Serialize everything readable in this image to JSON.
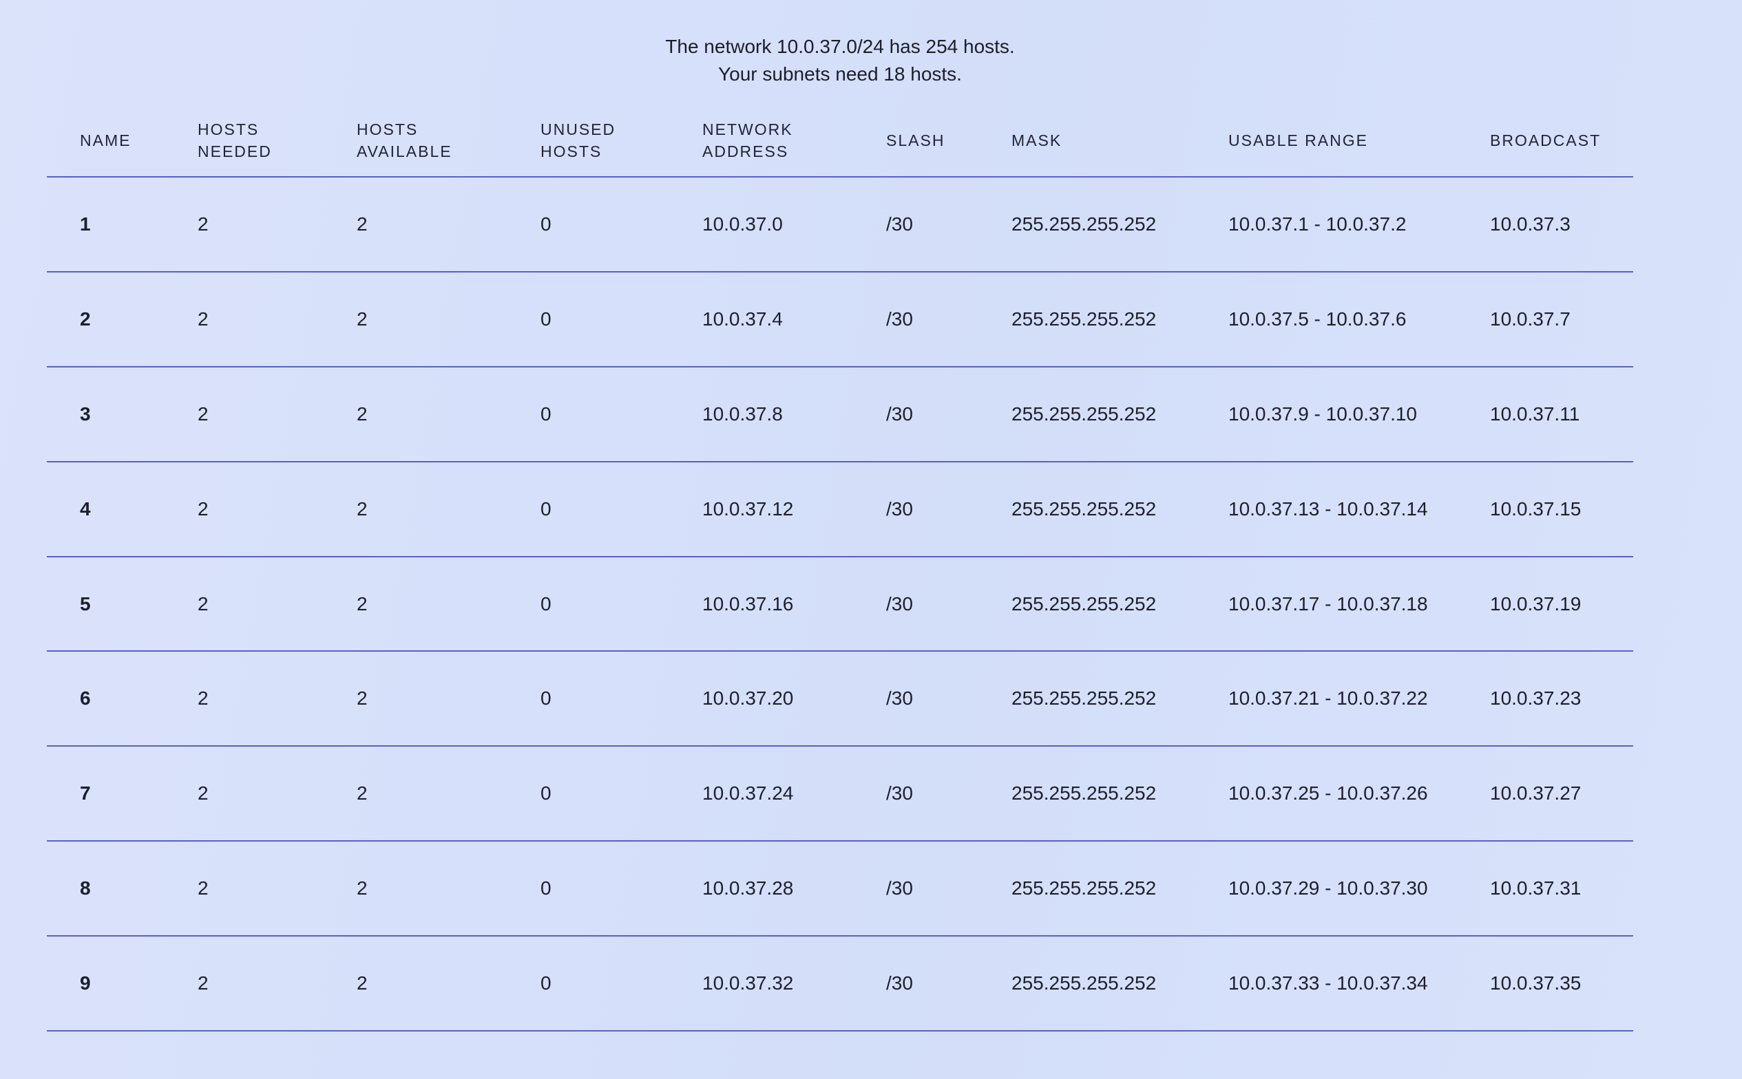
{
  "summary": {
    "line1": "The network 10.0.37.0/24 has 254 hosts.",
    "line2": "Your subnets need 18 hosts."
  },
  "table": {
    "headers": {
      "name": "NAME",
      "hosts_needed": "HOSTS\nNEEDED",
      "hosts_available": "HOSTS\nAVAILABLE",
      "unused_hosts": "UNUSED\nHOSTS",
      "network_address": "NETWORK\nADDRESS",
      "slash": "SLASH",
      "mask": "MASK",
      "usable_range": "USABLE RANGE",
      "broadcast": "BROADCAST"
    },
    "rows": [
      {
        "name": "1",
        "hosts_needed": "2",
        "hosts_available": "2",
        "unused_hosts": "0",
        "network_address": "10.0.37.0",
        "slash": "/30",
        "mask": "255.255.255.252",
        "usable_range": "10.0.37.1 - 10.0.37.2",
        "broadcast": "10.0.37.3"
      },
      {
        "name": "2",
        "hosts_needed": "2",
        "hosts_available": "2",
        "unused_hosts": "0",
        "network_address": "10.0.37.4",
        "slash": "/30",
        "mask": "255.255.255.252",
        "usable_range": "10.0.37.5 - 10.0.37.6",
        "broadcast": "10.0.37.7"
      },
      {
        "name": "3",
        "hosts_needed": "2",
        "hosts_available": "2",
        "unused_hosts": "0",
        "network_address": "10.0.37.8",
        "slash": "/30",
        "mask": "255.255.255.252",
        "usable_range": "10.0.37.9 - 10.0.37.10",
        "broadcast": "10.0.37.11"
      },
      {
        "name": "4",
        "hosts_needed": "2",
        "hosts_available": "2",
        "unused_hosts": "0",
        "network_address": "10.0.37.12",
        "slash": "/30",
        "mask": "255.255.255.252",
        "usable_range": "10.0.37.13 - 10.0.37.14",
        "broadcast": "10.0.37.15"
      },
      {
        "name": "5",
        "hosts_needed": "2",
        "hosts_available": "2",
        "unused_hosts": "0",
        "network_address": "10.0.37.16",
        "slash": "/30",
        "mask": "255.255.255.252",
        "usable_range": "10.0.37.17 - 10.0.37.18",
        "broadcast": "10.0.37.19"
      },
      {
        "name": "6",
        "hosts_needed": "2",
        "hosts_available": "2",
        "unused_hosts": "0",
        "network_address": "10.0.37.20",
        "slash": "/30",
        "mask": "255.255.255.252",
        "usable_range": "10.0.37.21 - 10.0.37.22",
        "broadcast": "10.0.37.23"
      },
      {
        "name": "7",
        "hosts_needed": "2",
        "hosts_available": "2",
        "unused_hosts": "0",
        "network_address": "10.0.37.24",
        "slash": "/30",
        "mask": "255.255.255.252",
        "usable_range": "10.0.37.25 - 10.0.37.26",
        "broadcast": "10.0.37.27"
      },
      {
        "name": "8",
        "hosts_needed": "2",
        "hosts_available": "2",
        "unused_hosts": "0",
        "network_address": "10.0.37.28",
        "slash": "/30",
        "mask": "255.255.255.252",
        "usable_range": "10.0.37.29 - 10.0.37.30",
        "broadcast": "10.0.37.31"
      },
      {
        "name": "9",
        "hosts_needed": "2",
        "hosts_available": "2",
        "unused_hosts": "0",
        "network_address": "10.0.37.32",
        "slash": "/30",
        "mask": "255.255.255.252",
        "usable_range": "10.0.37.33 - 10.0.37.34",
        "broadcast": "10.0.37.35"
      }
    ]
  }
}
